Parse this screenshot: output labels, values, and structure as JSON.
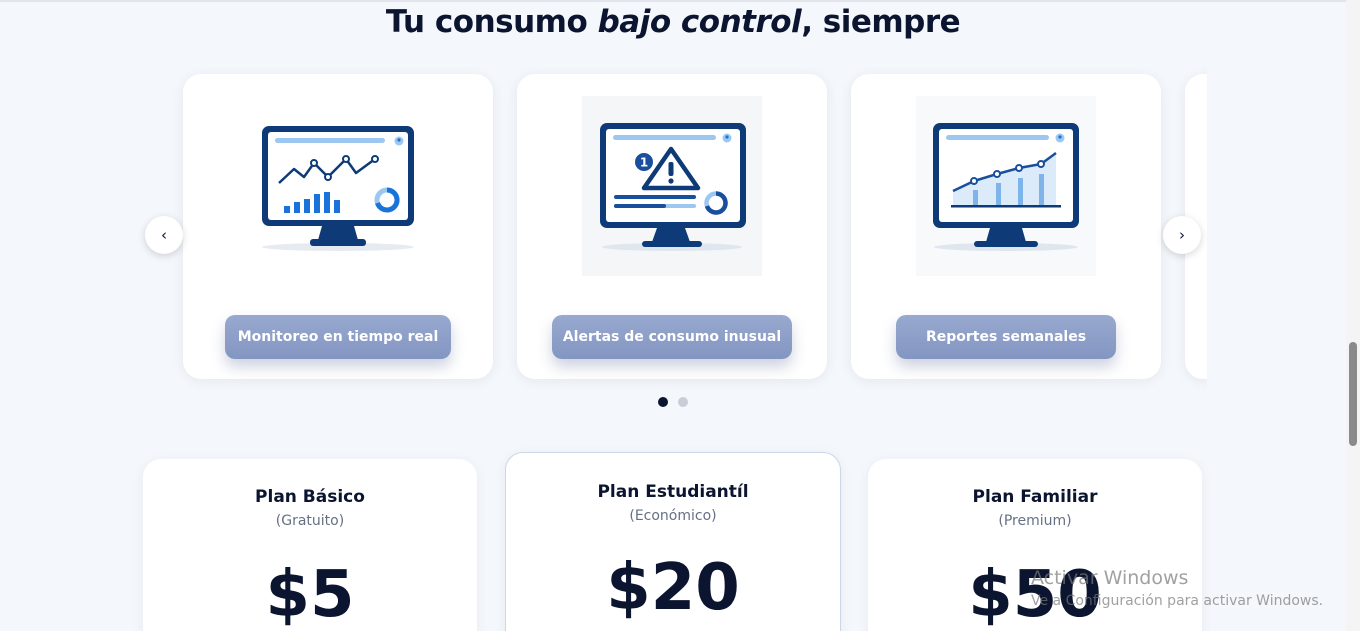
{
  "headline": {
    "part1": "Tu consumo ",
    "emphasis": "bajo control",
    "part2": ", siempre"
  },
  "carousel": {
    "prev_icon": "chevron-left-icon",
    "prev_glyph": "‹",
    "next_icon": "chevron-right-icon",
    "next_glyph": "›",
    "cards": [
      {
        "label": "Monitoreo en tiempo real",
        "icon": "monitor-chart-icon"
      },
      {
        "label": "Alertas de consumo inusual",
        "icon": "monitor-alert-icon"
      },
      {
        "label": "Reportes semanales",
        "icon": "monitor-report-icon"
      }
    ],
    "pages": 2,
    "active_page": 1
  },
  "plans": [
    {
      "name": "Plan Básico",
      "tier": "(Gratuito)",
      "price": "$5"
    },
    {
      "name": "Plan Estudiantíl",
      "tier": "(Económico)",
      "price": "$20"
    },
    {
      "name": "Plan Familiar",
      "tier": "(Premium)",
      "price": "$50"
    }
  ],
  "watermark": {
    "title": "Activar Windows",
    "subtitle": "Ve a Configuración para activar Windows."
  },
  "colors": {
    "background": "#f4f7fb",
    "navy": "#0f3a78",
    "accent_blue": "#1a73d9",
    "light_blue": "#9cc7f0",
    "pill": "#8e9fc9",
    "dot_active": "#0b1530",
    "dot_inactive": "#c9ced6"
  }
}
